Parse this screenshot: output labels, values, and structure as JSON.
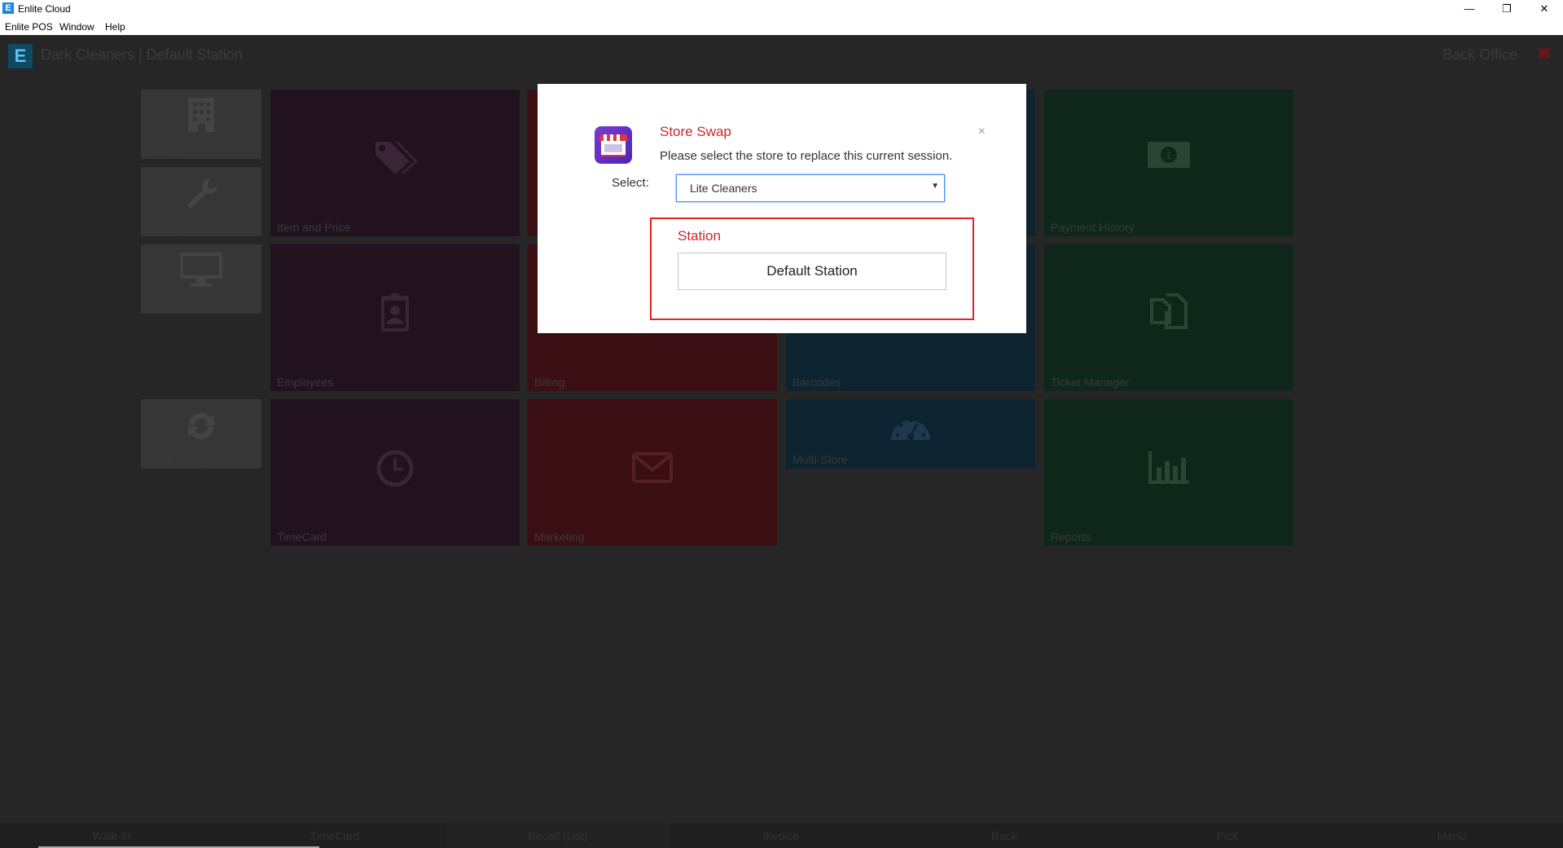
{
  "window": {
    "title": "Enlite Cloud",
    "icon_letter": "E",
    "minimize": "—",
    "restore": "❐",
    "close": "✕"
  },
  "menubar": [
    "Enlite POS",
    "Window",
    "Help"
  ],
  "header": {
    "logo_letter": "E",
    "title": "Dark Cleaners | Default Station",
    "back_office": "Back Office",
    "close": "✖"
  },
  "tiles": {
    "config": "Config",
    "settings": "Settings",
    "stations": "Stations",
    "store_swap": "Store Swap",
    "item_and_price": "Item and Price",
    "employees": "Employees",
    "timecard": "TimeCard",
    "billing": "Billing",
    "marketing": "Marketing",
    "barcodes": "Barcodes",
    "multi_store": "Multi-Store",
    "payment_history": "Payment History",
    "ticket_manager": "Ticket Manager",
    "reports": "Reports"
  },
  "bottom_bar": [
    "Walk-In",
    "TimeCard",
    "Recall (List)",
    "Invoice",
    "Rack",
    "Pick",
    "Menu"
  ],
  "modal": {
    "title": "Store Swap",
    "description": "Please select the store to replace this current session.",
    "close": "×",
    "select_label": "Select:",
    "selected_store": "Lite Cleaners",
    "arrow": "▼",
    "station_heading": "Station",
    "station_button": "Default Station"
  },
  "colors": {
    "modal_title": "#c8282e",
    "highlight_border": "#e52028",
    "select_focus": "#4d90fe"
  }
}
